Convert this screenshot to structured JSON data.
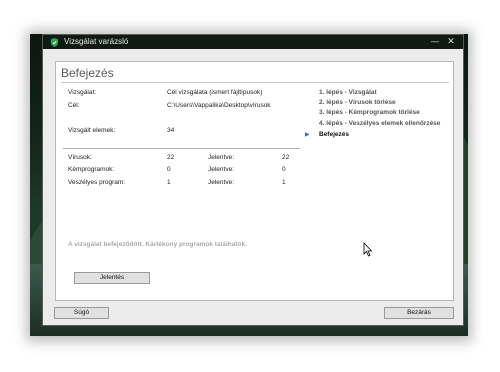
{
  "window": {
    "title": "Vizsgálat varázsló",
    "controls": {
      "minimize": "—",
      "close": "✕"
    }
  },
  "page": {
    "heading": "Befejezés"
  },
  "scan": {
    "scan_label": "Vizsgálat:",
    "scan_value": "Cél vizsgálata (ismert fájltípusok)",
    "target_label": "Cél:",
    "target_value": "C:\\Users\\Vappalika\\Desktop\\vírusok",
    "scanned_label": "Vizsgált elemek:",
    "scanned_value": "34"
  },
  "results": [
    {
      "label": "Vírusok:",
      "count": "22",
      "reported_label": "Jelentve:",
      "reported": "22"
    },
    {
      "label": "Kémprogramok:",
      "count": "0",
      "reported_label": "Jelentve:",
      "reported": "0"
    },
    {
      "label": "Veszélyes program:",
      "count": "1",
      "reported_label": "Jelentve:",
      "reported": "1"
    }
  ],
  "steps": [
    "1. lépés - Vizsgálat",
    "2. lépés - Vírusok törlése",
    "3. lépés - Kémprogramok törlése",
    "4. lépés - Veszélyes elemek ellenőrzése",
    "Befejezés"
  ],
  "active_step_index": 4,
  "status_message": "A vizsgálat befejeződött. Kártékony programok találhatók.",
  "buttons": {
    "report": "Jelentés",
    "help": "Súgó",
    "close": "Bezárás"
  },
  "colors": {
    "titlebar": "#0e1a12",
    "accent": "#3a6fd8",
    "shield": "#2e9e4f"
  },
  "icons": {
    "window": "shield-icon",
    "step_marker": "triangle-right-icon",
    "cursor": "mouse-pointer-icon"
  }
}
